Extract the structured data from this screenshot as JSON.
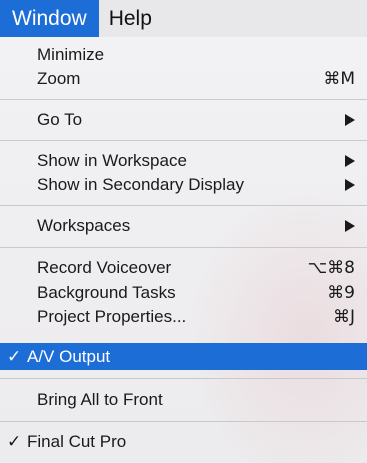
{
  "menubar": {
    "window": "Window",
    "help": "Help"
  },
  "menu": {
    "minimize": "Minimize",
    "zoom": "Zoom",
    "zoom_shortcut": "⌘M",
    "goto": "Go To",
    "show_in_workspace": "Show in Workspace",
    "show_in_secondary": "Show in Secondary Display",
    "workspaces": "Workspaces",
    "record_voiceover": "Record Voiceover",
    "record_voiceover_shortcut": "⌥⌘8",
    "background_tasks": "Background Tasks",
    "background_tasks_shortcut": "⌘9",
    "project_properties": "Project Properties...",
    "project_properties_shortcut": "⌘J",
    "av_output": "A/V Output",
    "bring_all_to_front": "Bring All to Front",
    "final_cut_pro": "Final Cut Pro",
    "checkmark": "✓"
  },
  "colors": {
    "highlight": "#1d6dd6",
    "menu_bg": "#efeef0"
  }
}
